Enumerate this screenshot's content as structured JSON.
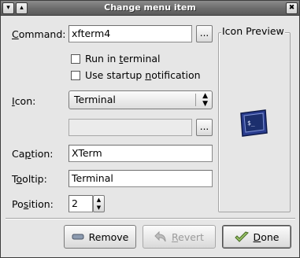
{
  "window": {
    "title": "Change menu item"
  },
  "titlebar": {
    "menu_glyph": "▾",
    "shade_glyph": "▴",
    "close_glyph": "✖"
  },
  "command": {
    "label_pre": "",
    "label_mn": "C",
    "label_post": "ommand:",
    "value": "xfterm4",
    "browse_label": "..."
  },
  "run_in_terminal": {
    "label_pre": "Run in ",
    "label_mn": "t",
    "label_post": "erminal",
    "checked": false
  },
  "startup_notification": {
    "label_pre": "Use startup ",
    "label_mn": "n",
    "label_post": "otification",
    "checked": false
  },
  "icon": {
    "label_pre": "",
    "label_mn": "I",
    "label_post": "con:",
    "selected": "Terminal",
    "file_value": "",
    "browse_label": "..."
  },
  "caption": {
    "label_pre": "Ca",
    "label_mn": "p",
    "label_post": "tion:",
    "value": "XTerm"
  },
  "tooltip": {
    "label_pre": "T",
    "label_mn": "o",
    "label_post": "oltip:",
    "value": "Terminal"
  },
  "position": {
    "label_pre": "Po",
    "label_mn": "s",
    "label_post": "ition:",
    "value": "2"
  },
  "preview": {
    "label": "Icon Preview",
    "icon": "terminal-icon",
    "screen_text": "$_"
  },
  "buttons": {
    "remove": {
      "label_pre": "Remove",
      "label_mn": "",
      "label_post": "",
      "icon": "minus-icon"
    },
    "revert": {
      "label_pre": "",
      "label_mn": "R",
      "label_post": "evert",
      "icon": "undo-icon",
      "enabled": false
    },
    "done": {
      "label_pre": "",
      "label_mn": "D",
      "label_post": "one",
      "icon": "check-icon"
    }
  },
  "colors": {
    "titlebar": "#6b6b6b",
    "window_bg": "#e6e6e6",
    "terminal_screen": "#1c2f6e"
  }
}
